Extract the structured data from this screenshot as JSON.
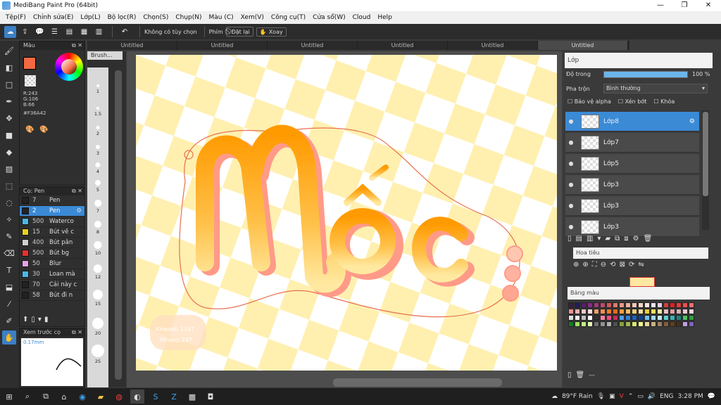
{
  "window": {
    "title": "MediBang Paint Pro (64bit)"
  },
  "menu": [
    "Tệp(F)",
    "Chỉnh sửa(E)",
    "Lớp(L)",
    "Bộ lọc(R)",
    "Chọn(S)",
    "Chụp(N)",
    "Màu (C)",
    "Xem(V)",
    "Công cụ(T)",
    "Cửa sổ(W)",
    "Cloud",
    "Help"
  ],
  "toolbar": {
    "no_option": "Không có tùy chọn",
    "key_label": "Phím",
    "reset_label": "Đặt lại",
    "rotate_label": "Xoay"
  },
  "tabs": [
    "Untitled",
    "Untitled",
    "Untitled",
    "Untitled",
    "Untitled",
    "Untitled"
  ],
  "color_panel": {
    "title": "Màu",
    "r": "R:243",
    "g": "G:106",
    "b": "B:66",
    "hex": "#F36A42",
    "fg_color": "#F36A42"
  },
  "brush_panel": {
    "title": "Cọ: Pen",
    "brushes": [
      {
        "size": "7",
        "name": "Pen",
        "color": "#222222"
      },
      {
        "size": "2",
        "name": "Pen",
        "color": "#222222",
        "selected": true
      },
      {
        "size": "500",
        "name": "Waterco",
        "color": "#4ab8e8"
      },
      {
        "size": "15",
        "name": "Bút vẽ c",
        "color": "#e8d020"
      },
      {
        "size": "400",
        "name": "Bút pân",
        "color": "#cfcfcf"
      },
      {
        "size": "500",
        "name": "Bút bg",
        "color": "#e83030"
      },
      {
        "size": "50",
        "name": "Blur",
        "color": "#e8a0e8"
      },
      {
        "size": "30",
        "name": "Loan mà",
        "color": "#4ab8e8"
      },
      {
        "size": "70",
        "name": "Cải này c",
        "color": "#222222"
      },
      {
        "size": "58",
        "name": "Bút đi n",
        "color": "#222222"
      }
    ]
  },
  "preview_panel": {
    "title": "Xem trước cọ",
    "size": "0.17mm"
  },
  "brush_size_panel": {
    "title": "Brush...",
    "sizes": [
      "1",
      "1.5",
      "2",
      "3",
      "4",
      "5",
      "7",
      "8",
      "10",
      "12",
      "15",
      "20",
      "25"
    ]
  },
  "canvas": {
    "text_main": "Mốc",
    "signature_line1": "Khiemlk 1197",
    "signature_line2": "tfindep.247"
  },
  "layer_panel": {
    "title": "Lớp",
    "opacity_label": "Độ trong",
    "opacity_value": "100 %",
    "opacity": 1.0,
    "blend_label": "Pha trộn",
    "blend_value": "Bình thường",
    "protect_alpha": "Bảo vệ alpha",
    "clip": "Xén bớt",
    "lock": "Khóa",
    "layers": [
      {
        "name": "Lớp8",
        "selected": true
      },
      {
        "name": "Lớp7"
      },
      {
        "name": "Lớp5"
      },
      {
        "name": "Lớp3"
      },
      {
        "name": "Lớp3"
      },
      {
        "name": "Lớp3"
      }
    ]
  },
  "navigator": {
    "title": "Hoa tiêu"
  },
  "palette": {
    "title": "Bảng màu",
    "extra": "---",
    "colors": [
      "#3b2040",
      "#1e1e5a",
      "#5a1e6e",
      "#8a2a8a",
      "#a03a7a",
      "#c04a6a",
      "#d05a5a",
      "#e07a6a",
      "#e89a8a",
      "#f0b0a0",
      "#f5c8b8",
      "#f8d8c8",
      "#fae8e0",
      "#f0e0f0",
      "#e0d0e8",
      "#d04040",
      "#e02020",
      "#e83a3a",
      "#f05050",
      "#f07070",
      "#f09090",
      "#f0b0b0",
      "#f8c8c8",
      "#ffe0e0",
      "#f0a070",
      "#f09050",
      "#f07a30",
      "#e86a20",
      "#f8a040",
      "#f8c060",
      "#f8d080",
      "#f8e0a0",
      "#f0d030",
      "#f8e060",
      "#f8f0a0",
      "#e8c0c0",
      "#e0a0a0",
      "#d8b0b8",
      "#f0c8d0",
      "#f8d8e0",
      "#e0e0e0",
      "#f0f0f0",
      "#c0c0c0",
      "#ffffff",
      "#303030",
      "#ff80a0",
      "#e85080",
      "#c03060",
      "#50a0f0",
      "#3080e0",
      "#2060c0",
      "#104090",
      "#70c0f0",
      "#a0d8f8",
      "#c0e8f8",
      "#60d0d0",
      "#40b0b0",
      "#208080",
      "#50c060",
      "#30a040",
      "#108020",
      "#a0e060",
      "#c0f080",
      "#e0f8b0",
      "#707070",
      "#909090",
      "#b0b0b0",
      "#505050",
      "#8aa040",
      "#a0b850",
      "#d8e870",
      "#f0f890",
      "#e8d8a0",
      "#c8b080",
      "#a08060",
      "#806040",
      "#604020",
      "#403020",
      "#c0a0e0",
      "#8060c0"
    ]
  },
  "taskbar": {
    "weather": "89°F Rain",
    "lang": "ENG",
    "time": "3:28 PM"
  }
}
